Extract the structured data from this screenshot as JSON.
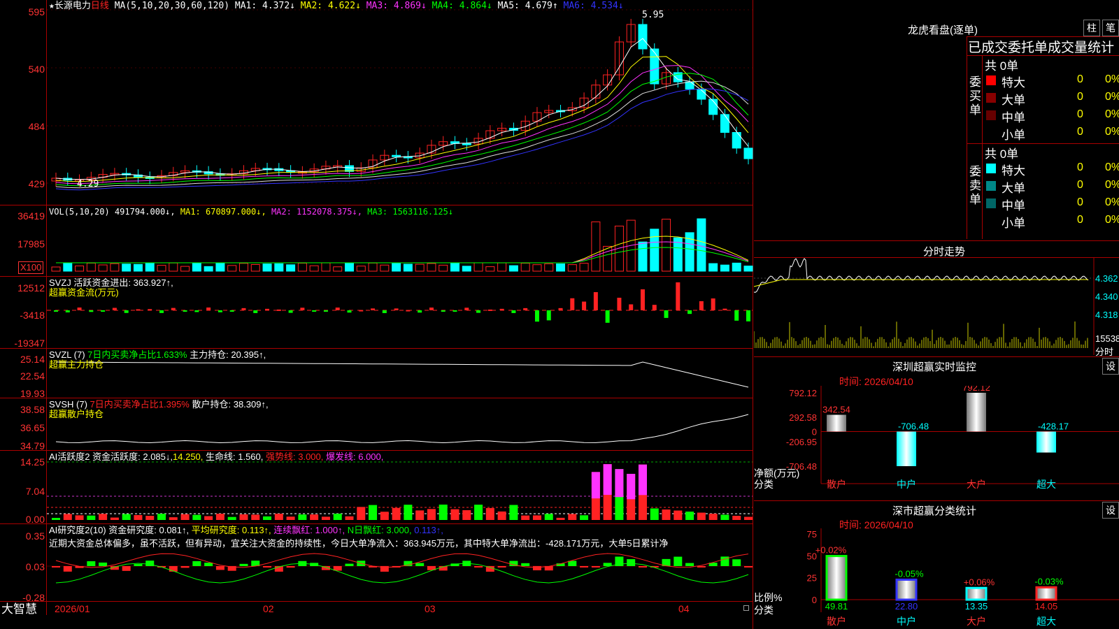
{
  "header": {
    "star": "★",
    "stock_name": "长源电力",
    "period": "日线",
    "ma_params": "MA(5,10,20,30,60,120)",
    "ma": [
      {
        "label": "MA1:",
        "value": "4.372↓",
        "color": "#ffffff"
      },
      {
        "label": "MA2:",
        "value": "4.622↓",
        "color": "#ffff00"
      },
      {
        "label": "MA3:",
        "value": "4.869↓",
        "color": "#ff33ff"
      },
      {
        "label": "MA4:",
        "value": "4.864↓",
        "color": "#00ff00"
      },
      {
        "label": "MA5:",
        "value": "4.679↑",
        "color": "#ffffff"
      },
      {
        "label": "MA6:",
        "value": "4.534↓",
        "color": "#3333ff"
      }
    ],
    "high_mark": "5.95",
    "low_mark": "4.29"
  },
  "price_axis": [
    "595",
    "540",
    "484",
    "429"
  ],
  "vol": {
    "title": "VOL(5,10,20)",
    "value": "491794.000↓,",
    "ma1": "MA1: 670897.000↓,",
    "ma2": "MA2: 1152078.375↓,",
    "ma3": "MA3: 1563116.125↓",
    "axis": [
      "36419",
      "17985"
    ],
    "unit": "X100"
  },
  "svzj": {
    "line1": "SVZJ  活跃资金进出: 363.927↑,",
    "line2": "超赢资金流(万元)",
    "axis": [
      "12512",
      "-3418",
      "-19347"
    ]
  },
  "svzl": {
    "title": "SVZL (7)",
    "ratio": "7日内买卖净占比1.633%",
    "hold": "主力持仓: 20.395↑,",
    "line2": "超赢主力持仓",
    "axis": [
      "25.14",
      "22.54",
      "19.93"
    ]
  },
  "svsh": {
    "title": "SVSH (7)",
    "ratio": "7日内买卖净占比1.395%",
    "hold": "散户持仓: 38.309↑,",
    "line2": "超赢散户持仓",
    "axis": [
      "38.58",
      "36.65",
      "34.79"
    ]
  },
  "ai_active": {
    "title": "AI活跃度2",
    "v1": "资金活跃度: 2.085↓,",
    "v2": "14.250,",
    "v3": "生命线: 1.560,",
    "v4": "强势线: 3.000,",
    "v5": "爆发线: 6.000,",
    "axis": [
      "14.25",
      "7.04",
      "0.00"
    ]
  },
  "ai_research": {
    "title": "AI研究度2(10)",
    "v1": "资金研究度: 0.081↑,",
    "v2": "平均研究度: 0.113↑,",
    "v3": "连续飘红: 1.000↑,",
    "v4": "N日飘红: 3.000,",
    "v5": "0.113↑,",
    "comment": "近期大资金总体偏多，虽不活跃，但有异动，宜关注大资金的持续性，今日大单净流入：363.945万元，其中特大单净流出：-428.171万元，大单5日累计净",
    "axis": [
      "0.35",
      "0.03",
      "-0.28"
    ]
  },
  "bottom_bar": {
    "brand": "大智慧",
    "dates": [
      "2026/01",
      "02",
      "03",
      "04"
    ]
  },
  "right": {
    "top_title": "龙虎看盘(逐单)",
    "btn_bar": "柱",
    "btn_pen": "笔",
    "section_title": "已成交委托单成交量统计",
    "buy_label": "委买单",
    "sell_label": "委卖单",
    "buy_total": "共 0单",
    "sell_total": "共 0单",
    "buy_rows": [
      {
        "name": "特大",
        "count": "0",
        "pct": "0%",
        "color": "#ff0000"
      },
      {
        "name": "大单",
        "count": "0",
        "pct": "0%",
        "color": "#880000"
      },
      {
        "name": "中单",
        "count": "0",
        "pct": "0%",
        "color": "#660000"
      },
      {
        "name": "小单",
        "count": "0",
        "pct": "0%",
        "color": "#000000"
      }
    ],
    "sell_rows": [
      {
        "name": "特大",
        "count": "0",
        "pct": "0%",
        "color": "#00ffff"
      },
      {
        "name": "大单",
        "count": "0",
        "pct": "0%",
        "color": "#008888"
      },
      {
        "name": "中单",
        "count": "0",
        "pct": "0%",
        "color": "#006666"
      },
      {
        "name": "小单",
        "count": "0",
        "pct": "0%",
        "color": "#000000"
      }
    ],
    "timeshare_title": "分时走势",
    "timeshare_axis": [
      "4.362",
      "4.340",
      "4.318"
    ],
    "timeshare_vol": [
      "15538",
      "分时"
    ],
    "sz_title": "深圳超赢实时监控",
    "sz_btn": "设",
    "sz_time": "时间: 2026/04/10",
    "sz_axis": [
      "792.12",
      "292.58",
      "0",
      "-206.95",
      "-706.48"
    ],
    "sz_ylabel": "净额(万元)",
    "sz_xlabel": "分类",
    "sz_categories": [
      "散户",
      "中户",
      "大户",
      "超大"
    ],
    "sz_values": [
      342.54,
      -706.48,
      792.12,
      -428.17
    ],
    "sz_value_labels": [
      "342.54",
      "-706.48",
      "792.12",
      "-428.17"
    ],
    "cls_title": "深市超赢分类统计",
    "cls_btn": "设",
    "cls_time": "时间: 2026/04/10",
    "cls_axis": [
      "75",
      "50",
      "25",
      "0"
    ],
    "cls_ylabel": "比例%",
    "cls_xlabel": "分类",
    "cls_categories": [
      "散户",
      "中户",
      "大户",
      "超大"
    ],
    "cls_values": [
      49.81,
      22.8,
      13.35,
      14.05
    ],
    "cls_value_labels": [
      "49.81",
      "22.80",
      "13.35",
      "14.05"
    ],
    "cls_changes": [
      "+0.02%",
      "-0.05%",
      "+0.06%",
      "-0.03%"
    ]
  }
}
